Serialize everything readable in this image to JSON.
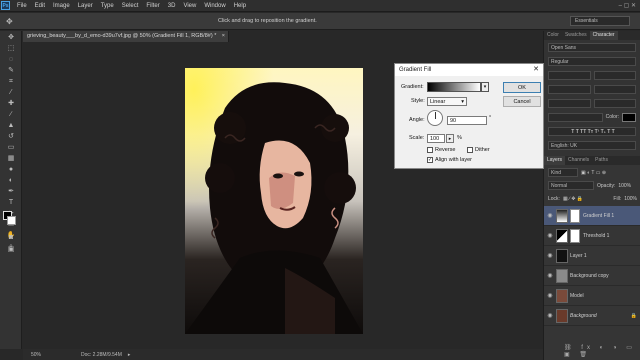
{
  "menubar": {
    "logo": "Ps",
    "items": [
      "File",
      "Edit",
      "Image",
      "Layer",
      "Type",
      "Select",
      "Filter",
      "3D",
      "View",
      "Window",
      "Help"
    ]
  },
  "options": {
    "hint": "Click and drag to reposition the gradient.",
    "workspace": "Essentials"
  },
  "document": {
    "tab_title": "grieving_beauty___by_d_emo-d39u7vf.jpg @ 50% (Gradient Fill 1, RGB/8#) *",
    "zoom": "50%",
    "doc_info": "Doc: 2.28M/9.54M"
  },
  "right_panel": {
    "top_tabs": [
      "Color",
      "Swatches",
      "Character"
    ],
    "font_family": "Open Sans",
    "font_style": "Regular",
    "color_label": "Color:",
    "language": "English: UK",
    "layers_tabs": [
      "Layers",
      "Channels",
      "Paths"
    ],
    "kind_label": "Kind",
    "blend_mode": "Normal",
    "opacity_label": "Opacity:",
    "opacity_value": "100%",
    "lock_label": "Lock:",
    "fill_label": "Fill:",
    "fill_value": "100%",
    "layers": [
      {
        "name": "Gradient Fill 1",
        "selected": true
      },
      {
        "name": "Threshold 1",
        "selected": false
      },
      {
        "name": "Layer 1",
        "selected": false
      },
      {
        "name": "Background copy",
        "selected": false
      },
      {
        "name": "Model",
        "selected": false
      },
      {
        "name": "Background",
        "selected": false
      }
    ]
  },
  "dialog": {
    "title": "Gradient Fill",
    "gradient_label": "Gradient:",
    "style_label": "Style:",
    "style_value": "Linear",
    "angle_label": "Angle:",
    "angle_value": "90",
    "angle_unit": "°",
    "scale_label": "Scale:",
    "scale_value": "100",
    "scale_unit": "%",
    "reverse_label": "Reverse",
    "dither_label": "Dither",
    "align_label": "Align with layer",
    "ok_label": "OK",
    "cancel_label": "Cancel",
    "reverse_checked": false,
    "dither_checked": false,
    "align_checked": true
  }
}
